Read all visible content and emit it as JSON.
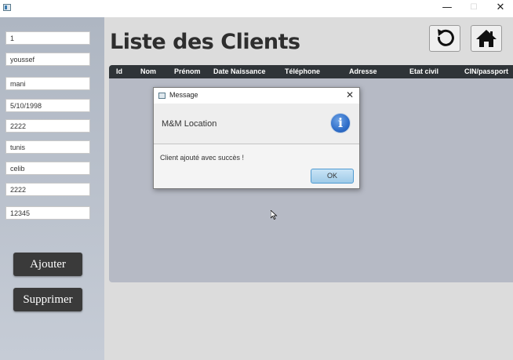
{
  "window": {
    "minimize_glyph": "—",
    "maximize_glyph": "☐",
    "close_glyph": "✕"
  },
  "sidebar": {
    "fields": [
      "1",
      "youssef",
      "mani",
      "5/10/1998",
      "2222",
      "tunis",
      "celib",
      "2222",
      "12345"
    ],
    "add_button": "Ajouter",
    "delete_button": "Supprimer"
  },
  "main": {
    "title": "Liste des Clients",
    "refresh_icon": "refresh-icon",
    "home_icon": "home-icon",
    "table": {
      "columns": [
        "Id",
        "Nom",
        "Prénom",
        "Date Naissance",
        "Téléphone",
        "Adresse",
        "Etat civil",
        "CIN/passport"
      ],
      "rows": []
    }
  },
  "dialog": {
    "title": "Message",
    "close_glyph": "✕",
    "header_text": "M&M Location",
    "info_glyph": "i",
    "content": "Client ajouté avec succès !",
    "ok_label": "OK"
  },
  "colors": {
    "table_header": "#2f3438",
    "table_body": "#b6bac5",
    "button_dark": "#3a3a3a",
    "info_blue": "#2f6ec9",
    "ok_button_border": "#4f9ad1"
  }
}
